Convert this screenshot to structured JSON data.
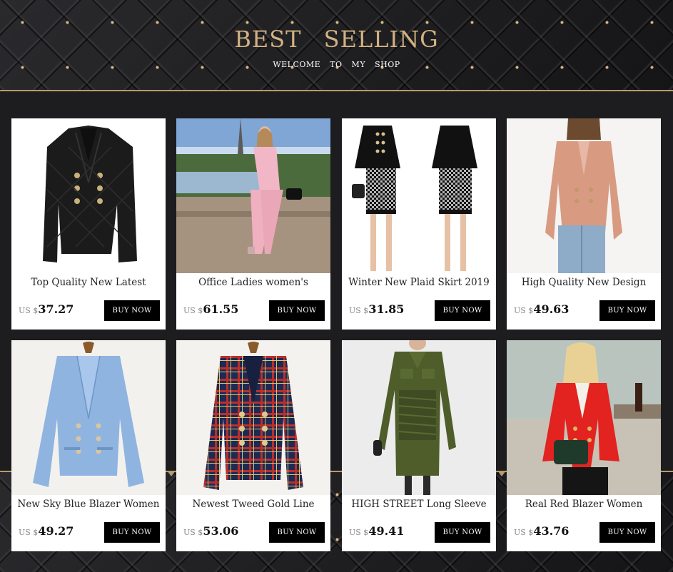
{
  "header": {
    "title": "BEST SELLING",
    "subtitle": "WELCOME TO MY SHOP"
  },
  "colors": {
    "title_gold": "#d3b182",
    "accent_line": "#b89a6c",
    "background": "#1d1d1f",
    "button_bg": "#000000"
  },
  "products": [
    {
      "name": "Top Quality New Latest",
      "currency": "US $",
      "price": "37.27",
      "button": "BUY NOW",
      "image": "black quilted leather double-breasted blazer"
    },
    {
      "name": "Office Ladies women's",
      "currency": "US $",
      "price": "61.55",
      "button": "BUY NOW",
      "image": "woman in pink suit sitting by Eiffel Tower"
    },
    {
      "name": "Winter New Plaid Skirt 2019",
      "currency": "US $",
      "price": "31.85",
      "button": "BUY NOW",
      "image": "black knit top with houndstooth skirt set"
    },
    {
      "name": "High Quality New Design",
      "currency": "US $",
      "price": "49.63",
      "button": "BUY NOW",
      "image": "woman in pink blazer and jeans"
    },
    {
      "name": "New Sky Blue Blazer Women",
      "currency": "US $",
      "price": "49.27",
      "button": "BUY NOW",
      "image": "sky blue double-breasted blazer on hanger"
    },
    {
      "name": "Newest Tweed Gold Line",
      "currency": "US $",
      "price": "53.06",
      "button": "BUY NOW",
      "image": "plaid tweed double-breasted blazer on hanger"
    },
    {
      "name": "HIGH STREET Long Sleeve",
      "currency": "US $",
      "price": "49.41",
      "button": "BUY NOW",
      "image": "olive green utility shirt dress"
    },
    {
      "name": "Real Red Blazer Women",
      "currency": "US $",
      "price": "43.76",
      "button": "BUY NOW",
      "image": "woman in red blazer with black bag"
    }
  ]
}
